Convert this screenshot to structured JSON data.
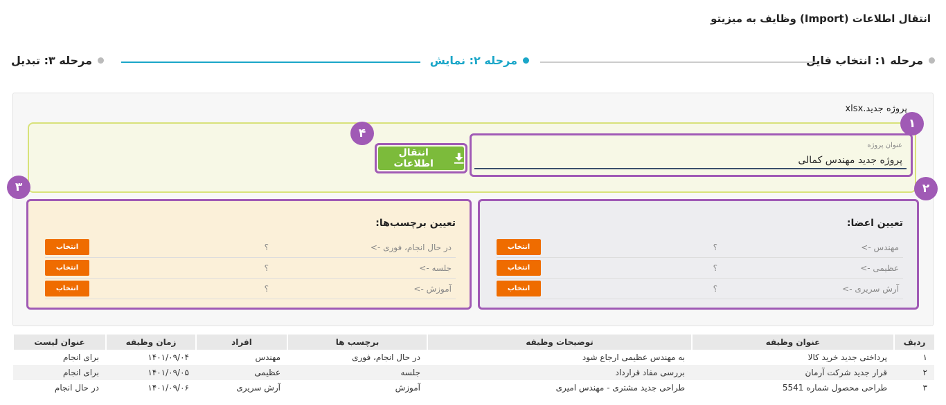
{
  "page_title": "انتقال اطلاعات (Import) وظایف به میزیتو",
  "stepper": {
    "step1": "مرحله ۱: انتخاب فایل",
    "step2": "مرحله ۲: نمایش",
    "step3": "مرحله ۳: تبدیل",
    "active_color": "#1aa6c8"
  },
  "filename": "پروژه جدید.xlsx",
  "project_title": {
    "label": "عنوان پروژه",
    "value": "پروژه جدید مهندس کمالی"
  },
  "import_button": "انتقال اطلاعات",
  "badges": [
    "۱",
    "۲",
    "۳",
    "۴"
  ],
  "members": {
    "title": "تعیین اعضا:",
    "rows": [
      {
        "name": "مهندس ->",
        "value": "؟",
        "button": "انتخاب"
      },
      {
        "name": "عظیمی ->",
        "value": "؟",
        "button": "انتخاب"
      },
      {
        "name": "آرش سریری ->",
        "value": "؟",
        "button": "انتخاب"
      }
    ]
  },
  "tags": {
    "title": "تعیین برچسب‌ها:",
    "rows": [
      {
        "name": "در حال انجام، فوری ->",
        "value": "؟",
        "button": "انتخاب"
      },
      {
        "name": "جلسه ->",
        "value": "؟",
        "button": "انتخاب"
      },
      {
        "name": "آموزش ->",
        "value": "؟",
        "button": "انتخاب"
      }
    ]
  },
  "table": {
    "headers": [
      "ردیف",
      "عنوان وظیفه",
      "توضیحات وظیفه",
      "برچسب ها",
      "افراد",
      "زمان وظیفه",
      "عنوان لیست"
    ],
    "rows": [
      [
        "۱",
        "پرداختی جدید خرید کالا",
        "به مهندس عظیمی ارجاع شود",
        "در حال انجام، فوری",
        "مهندس",
        "۱۴۰۱/۰۹/۰۴",
        "برای انجام"
      ],
      [
        "۲",
        "قرار جدید شرکت آرمان",
        "بررسی مفاد قرارداد",
        "جلسه",
        "عظیمی",
        "۱۴۰۱/۰۹/۰۵",
        "برای انجام"
      ],
      [
        "۳",
        "طراحی محصول شماره 5541",
        "طراحی جدید مشتری - مهندس امیری",
        "آموزش",
        "آرش سریری",
        "۱۴۰۱/۰۹/۰۶",
        "در حال انجام"
      ]
    ]
  },
  "colors": {
    "highlight": "#a05ab5",
    "import_button": "#7cbb3b",
    "select_button": "#ef6c00"
  }
}
